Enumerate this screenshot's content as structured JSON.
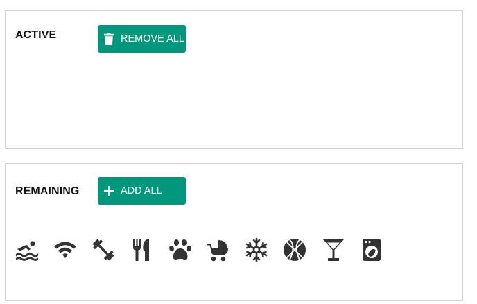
{
  "colors": {
    "accent": "#00977D",
    "icon": "#333333",
    "panel_border": "#d2d2d2"
  },
  "active": {
    "title": "ACTIVE",
    "button_label": "REMOVE ALL",
    "button_icon": "trash-icon",
    "items": []
  },
  "remaining": {
    "title": "REMAINING",
    "button_label": "ADD ALL",
    "button_icon": "plus-icon",
    "items": [
      {
        "icon": "swimming-icon",
        "name": "swimming"
      },
      {
        "icon": "wifi-icon",
        "name": "wifi"
      },
      {
        "icon": "dumbbell-icon",
        "name": "gym"
      },
      {
        "icon": "restaurant-icon",
        "name": "restaurant"
      },
      {
        "icon": "paw-icon",
        "name": "pets"
      },
      {
        "icon": "stroller-icon",
        "name": "baby-stroller"
      },
      {
        "icon": "snowflake-icon",
        "name": "air-conditioning"
      },
      {
        "icon": "basketball-icon",
        "name": "basketball"
      },
      {
        "icon": "cocktail-icon",
        "name": "bar"
      },
      {
        "icon": "washing-machine-icon",
        "name": "laundry"
      }
    ]
  }
}
